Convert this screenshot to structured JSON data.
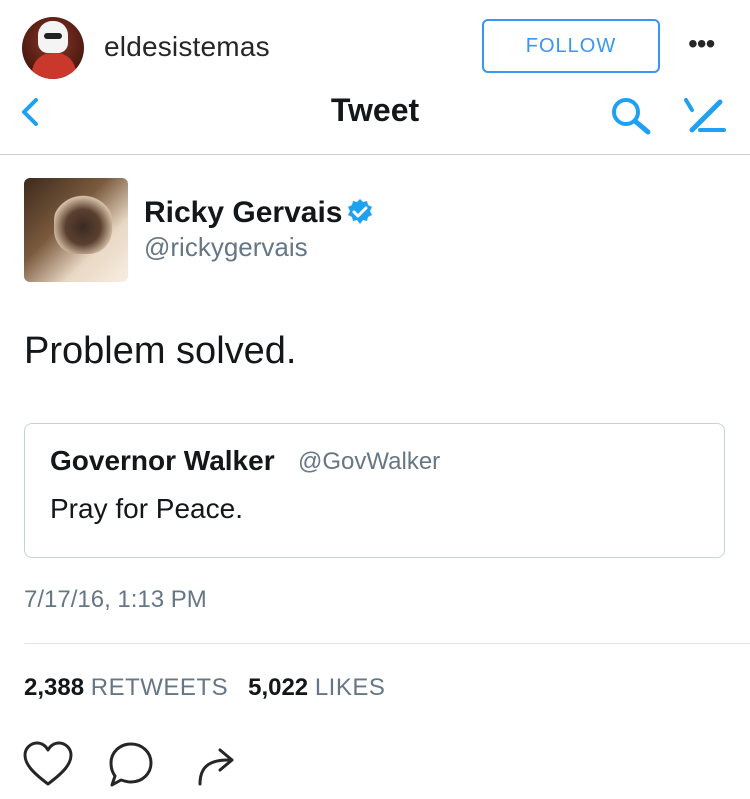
{
  "instagram": {
    "username": "eldesistemas",
    "follow_label": "FOLLOW",
    "more_label": "•••"
  },
  "twitter_nav": {
    "back_label": "<",
    "title": "Tweet"
  },
  "tweet": {
    "author_name": "Ricky Gervais",
    "author_handle": "@rickygervais",
    "text": "Problem solved.",
    "quoted": {
      "author_name": "Governor Walker",
      "author_handle": "@GovWalker",
      "text": "Pray for Peace."
    },
    "timestamp": "7/17/16, 1:13 PM",
    "retweets_count": "2,388",
    "retweets_label": "RETWEETS",
    "likes_count": "5,022",
    "likes_label": "LIKES"
  },
  "colors": {
    "accent_blue": "#3897f0",
    "twitter_blue": "#1da1f2",
    "muted_gray": "#657786"
  },
  "icons": {
    "more": "ellipsis-icon",
    "back": "chevron-left-icon",
    "search": "search-icon",
    "compose": "compose-icon",
    "verified": "verified-badge-icon",
    "like": "heart-icon",
    "comment": "comment-icon",
    "share": "share-icon"
  }
}
